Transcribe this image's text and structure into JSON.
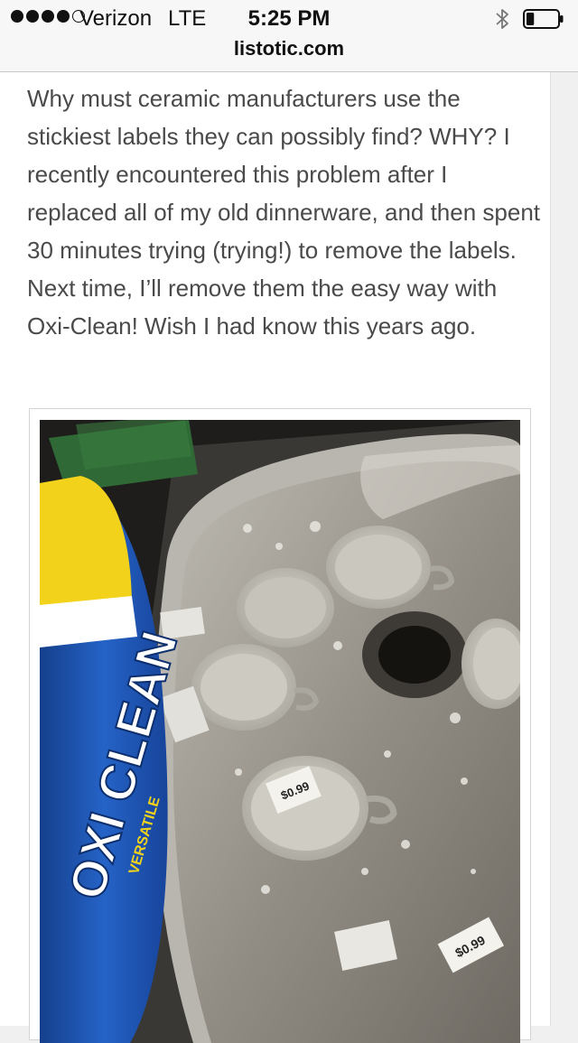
{
  "status_bar": {
    "signal_bars": 4,
    "signal_total": 5,
    "carrier": "Verizon",
    "network": "LTE",
    "time": "5:25 PM",
    "battery_level": 0.25
  },
  "browser": {
    "url": "listotic.com"
  },
  "article": {
    "paragraph": "Why must ceramic manufacturers use the stickiest labels they can possibly find? WHY? I recently encountered this problem after I replaced all of my old dinnerware, and then spent 30 minutes trying (trying!) to remove the labels. Next time, I’ll remove them the easy way with Oxi-Clean! Wish I had know this years ago."
  },
  "photo": {
    "tub_text": "OXI CLEAN",
    "tub_subtext": "VERSATILE",
    "price_label": "$0.99"
  },
  "colors": {
    "text": "#4a4a4a",
    "tub_lid": "#f2d21a",
    "tub_blue": "#1f57b8",
    "sponge": "#2f6a36",
    "sink_water": "#9a958c"
  }
}
